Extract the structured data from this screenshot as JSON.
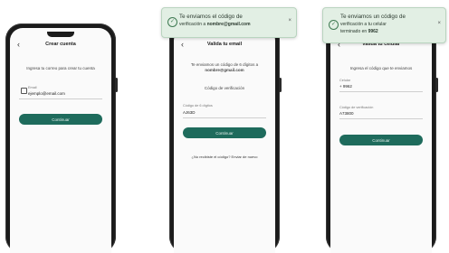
{
  "screen1": {
    "title": "Crear cuenta",
    "description": "Ingresa tu correo para crear tu cuenta",
    "email_label": "Email",
    "email_value": "ejemplo@email.com",
    "button_label": "Continuar"
  },
  "screen2": {
    "title": "Valida tu email",
    "description_prefix": "Te enviamos un código de 6 dígitos a",
    "email": "nombre@gmail.com",
    "field_placeholder": "Código de verificación",
    "field_label": "Código de 6 dígitos",
    "field_value": "AJ63D",
    "button_label": "Continuar",
    "resend_link": "¿No recibiste el código? Enviar de nuevo"
  },
  "screen3": {
    "title": "Valida tu celular",
    "description": "Ingresa el código que te enviamos",
    "phone_label": "Celular",
    "phone_value": "+ 9962",
    "code_label": "Código de verificación",
    "code_value": "A73800",
    "button_label": "Continuar"
  },
  "toast_email": {
    "title": "Te enviamos el código de",
    "body_prefix": "verificación a",
    "email": "nombre@gmail.com",
    "icon": "check-circle-icon"
  },
  "toast_phone": {
    "title": "Te enviamos un código de",
    "line2": "verificación a tu celular",
    "line3_prefix": "terminado en",
    "phone_suffix": "9962",
    "icon": "check-circle-icon"
  },
  "colors": {
    "primary": "#1e6b5c",
    "toast_bg": "#e2efe4",
    "phone_frame": "#1b1b1b"
  }
}
